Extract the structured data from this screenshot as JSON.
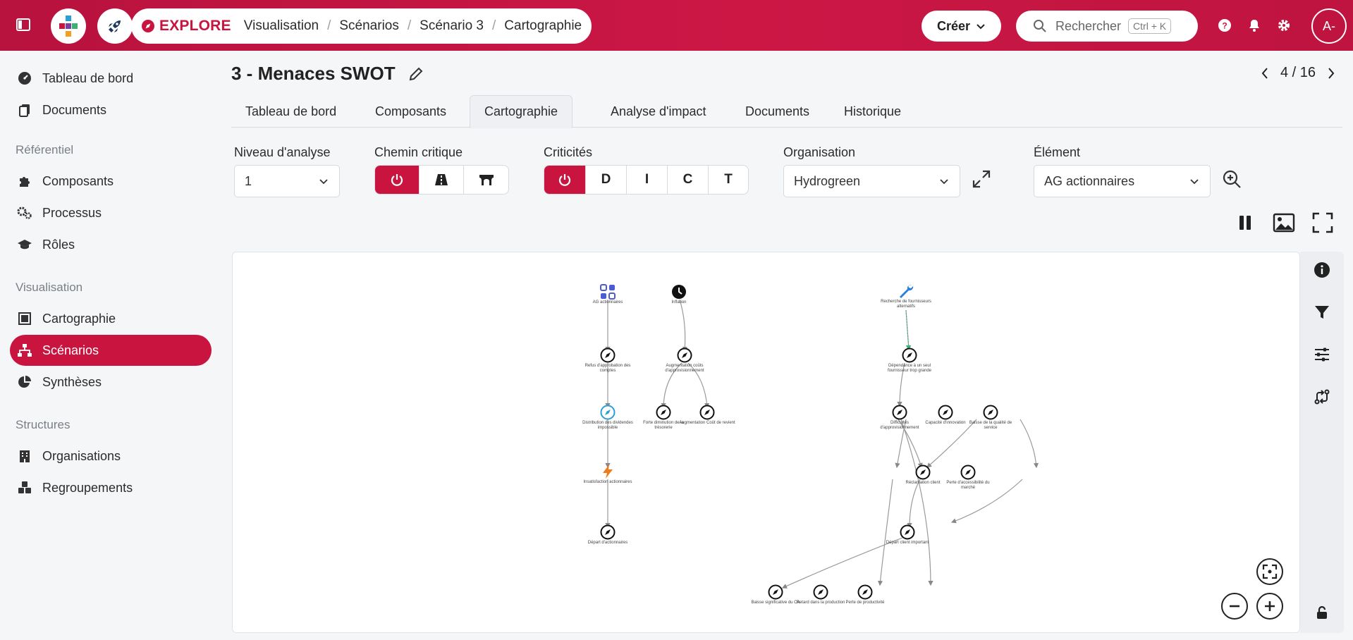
{
  "topbar": {
    "explore_label": "EXPLORE",
    "breadcrumb": [
      "Visualisation",
      "Scénarios",
      "Scénario 3",
      "Cartographie"
    ],
    "create_label": "Créer",
    "search_placeholder": "Rechercher",
    "search_shortcut": "Ctrl + K",
    "avatar_initials": "A-"
  },
  "sidebar": {
    "top_items": [
      {
        "label": "Tableau de bord",
        "icon": "gauge-icon"
      },
      {
        "label": "Documents",
        "icon": "documents-icon"
      }
    ],
    "sections": [
      {
        "title": "Référentiel",
        "items": [
          {
            "label": "Composants",
            "icon": "puzzle-icon"
          },
          {
            "label": "Processus",
            "icon": "gears-icon"
          },
          {
            "label": "Rôles",
            "icon": "graduation-cap-icon"
          }
        ]
      },
      {
        "title": "Visualisation",
        "items": [
          {
            "label": "Cartographie",
            "icon": "map-icon"
          },
          {
            "label": "Scénarios",
            "icon": "sitemap-icon",
            "active": true
          },
          {
            "label": "Synthèses",
            "icon": "pie-chart-icon"
          }
        ]
      },
      {
        "title": "Structures",
        "items": [
          {
            "label": "Organisations",
            "icon": "building-icon"
          },
          {
            "label": "Regroupements",
            "icon": "cubes-icon"
          }
        ]
      }
    ]
  },
  "page": {
    "title": "3 - Menaces SWOT",
    "pager": "4 / 16",
    "tabs": [
      "Tableau de bord",
      "Composants",
      "Cartographie",
      "Analyse d'impact",
      "Documents",
      "Historique"
    ],
    "active_tab": "Cartographie"
  },
  "filters": {
    "niveau_label": "Niveau d'analyse",
    "niveau_value": "1",
    "chemin_label": "Chemin critique",
    "criticites_label": "Criticités",
    "criticites_letters": [
      "D",
      "I",
      "C",
      "T"
    ],
    "organisation_label": "Organisation",
    "organisation_value": "Hydrogreen",
    "element_label": "Élément",
    "element_value": "AG actionnaires"
  },
  "graph": {
    "nodes": [
      {
        "id": "n1",
        "label": "AG actionnaires"
      },
      {
        "id": "n2",
        "label": "Refus d'approbation des comptes"
      },
      {
        "id": "n3",
        "label": "Distribution des dividendes impossible"
      },
      {
        "id": "n4",
        "label": "Insatisfaction actionnaires"
      },
      {
        "id": "n5",
        "label": "Départ d'actionnaires"
      },
      {
        "id": "n6",
        "label": "Inflation"
      },
      {
        "id": "n7",
        "label": "Augmentation coûts d'approvisionnement"
      },
      {
        "id": "n8",
        "label": "Forte diminution de la trésorerie"
      },
      {
        "id": "n9",
        "label": "Augmentation Coût de revient"
      },
      {
        "id": "n10",
        "label": "Recherche de fournisseurs alternatifs"
      },
      {
        "id": "n11",
        "label": "Dépendance à un seul fournisseur trop grande"
      },
      {
        "id": "n12",
        "label": "Difficultés d'approvisionnement"
      },
      {
        "id": "n13",
        "label": "Capacité d'innovation"
      },
      {
        "id": "n14",
        "label": "Baisse de la qualité de service"
      },
      {
        "id": "n15",
        "label": "Réclamation client"
      },
      {
        "id": "n16",
        "label": "Perte d'accessibilité du marché"
      },
      {
        "id": "n17",
        "label": "Départ client important"
      },
      {
        "id": "n18",
        "label": "Baisse significative du CA"
      },
      {
        "id": "n19",
        "label": "Retard dans la production"
      },
      {
        "id": "n20",
        "label": "Perte de productivité"
      }
    ]
  },
  "colors": {
    "brand": "#c8143f",
    "nav_active": "#c8143f"
  }
}
